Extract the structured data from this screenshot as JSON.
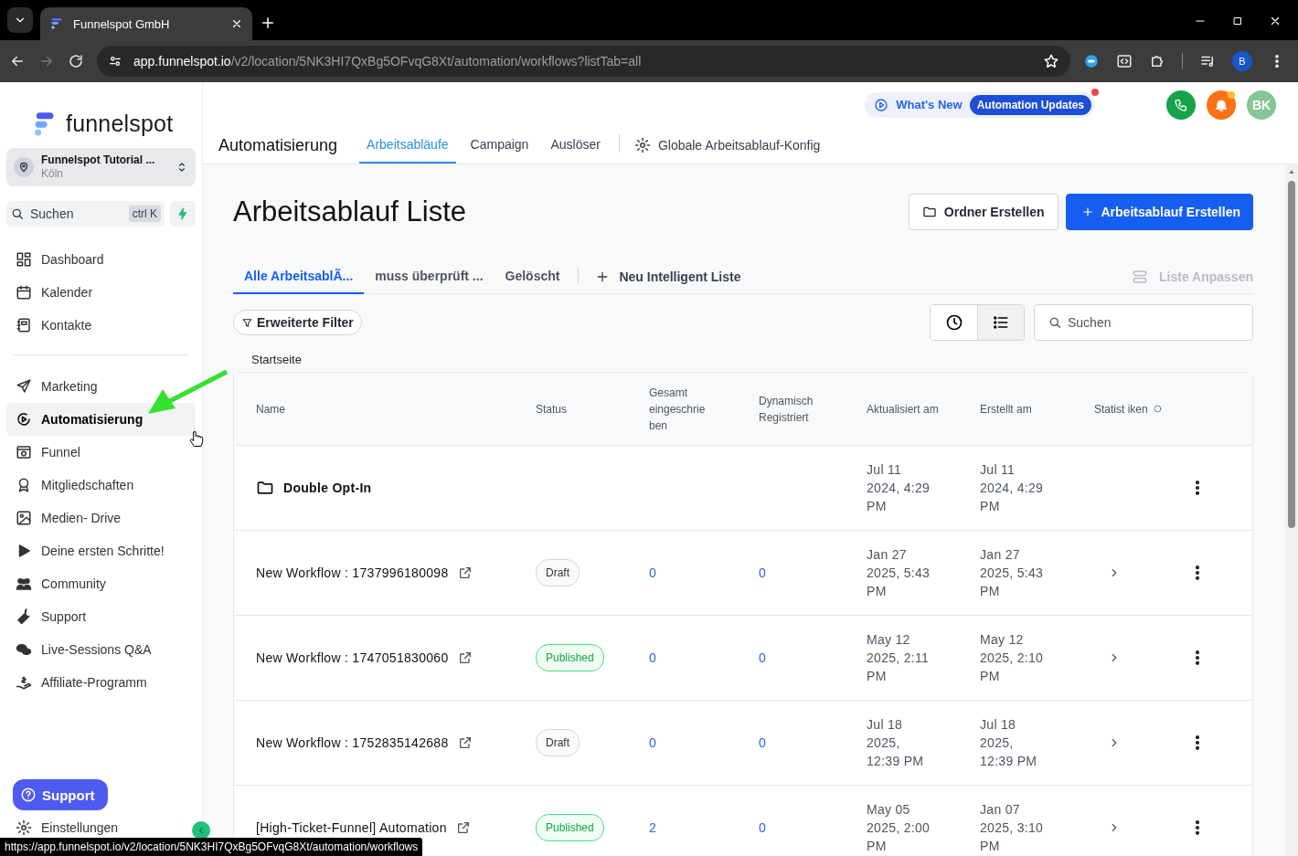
{
  "browser": {
    "tab_title": "Funnelspot GmbH",
    "url_host": "app.funnelspot.io",
    "url_path": "/v2/location/5NK3HI7QxBg5OFvqG8Xt/automation/workflows?listTab=all",
    "profile": "B",
    "status_url": "https://app.funnelspot.io/v2/location/5NK3HI7QxBg5OFvqG8Xt/automation/workflows"
  },
  "sidebar": {
    "logo_text": "funnelspot",
    "account": {
      "name": "Funnelspot Tutorial ...",
      "city": "Köln"
    },
    "search": {
      "placeholder": "Suchen",
      "shortcut": "ctrl K"
    },
    "groups": [
      [
        {
          "label": "Dashboard",
          "selected": false
        },
        {
          "label": "Kalender",
          "selected": false
        },
        {
          "label": "Kontakte",
          "selected": false
        }
      ],
      [
        {
          "label": "Marketing",
          "selected": false
        },
        {
          "label": "Automatisierung",
          "selected": true
        },
        {
          "label": "Funnel",
          "selected": false
        },
        {
          "label": "Mitgliedschaften",
          "selected": false
        },
        {
          "label": "Medien- Drive",
          "selected": false
        },
        {
          "label": "Deine ersten Schritte!",
          "selected": false
        },
        {
          "label": "Community",
          "selected": false
        },
        {
          "label": "Support",
          "selected": false
        },
        {
          "label": "Live-Sessions Q&A",
          "selected": false
        },
        {
          "label": "Affiliate-Programm",
          "selected": false
        }
      ]
    ],
    "support_button": "Support",
    "settings": "Einstellungen"
  },
  "header": {
    "title": "Automatisierung",
    "tabs": [
      {
        "label": "Arbeitsabläufe",
        "selected": true
      },
      {
        "label": "Campaign",
        "selected": false
      },
      {
        "label": "Auslöser",
        "selected": false
      }
    ],
    "config_tab": "Globale Arbeitsablauf-Konfig",
    "whats_new": "What's New",
    "updates_badge": "Automation Updates",
    "avatar": "BK"
  },
  "page": {
    "title": "Arbeitsablauf Liste",
    "folder_button": "Ordner Erstellen",
    "create_button": "Arbeitsablauf Erstellen",
    "list_tabs": [
      {
        "label": "Alle ArbeitsablÃ...",
        "selected": true
      },
      {
        "label": "muss überprüft ...",
        "selected": false
      },
      {
        "label": "Gelöscht",
        "selected": false
      }
    ],
    "new_list": "Neu Intelligent Liste",
    "customize": "Liste Anpassen",
    "filter": "Erweiterte Filter",
    "view_toggle": [
      {
        "selected": false
      },
      {
        "selected": true
      }
    ],
    "search": {
      "placeholder": "Suchen"
    },
    "breadcrumb": "Startseite"
  },
  "table": {
    "columns": [
      "Name",
      "Status",
      "Gesamt eingeschrie ben",
      "Dynamisch Registriert",
      "Aktualisiert am",
      "Erstellt am",
      "Statist iken"
    ],
    "rows": [
      {
        "kind": "folder",
        "name": "Double Opt-In",
        "updated": "Jul 11 2024, 4:29 PM",
        "created": "Jul 11 2024, 4:29 PM"
      },
      {
        "kind": "workflow",
        "name": "New Workflow : 1737996180098",
        "status": {
          "label": "Draft",
          "kind": "draft"
        },
        "enrolled": "0",
        "dynamic": "0",
        "updated": "Jan 27 2025, 5:43 PM",
        "created": "Jan 27 2025, 5:43 PM"
      },
      {
        "kind": "workflow",
        "name": "New Workflow : 1747051830060",
        "status": {
          "label": "Published",
          "kind": "published"
        },
        "enrolled": "0",
        "dynamic": "0",
        "updated": "May 12 2025, 2:11 PM",
        "created": "May 12 2025, 2:10 PM"
      },
      {
        "kind": "workflow",
        "name": "New Workflow : 1752835142688",
        "status": {
          "label": "Draft",
          "kind": "draft"
        },
        "enrolled": "0",
        "dynamic": "0",
        "updated": "Jul 18 2025, 12:39 PM",
        "created": "Jul 18 2025, 12:39 PM"
      },
      {
        "kind": "workflow",
        "name": "[High-Ticket-Funnel] Automation",
        "status": {
          "label": "Published",
          "kind": "published"
        },
        "enrolled": "2",
        "dynamic": "0",
        "updated": "May 05 2025, 2:00 PM",
        "created": "Jan 07 2025, 3:10 PM"
      }
    ]
  }
}
